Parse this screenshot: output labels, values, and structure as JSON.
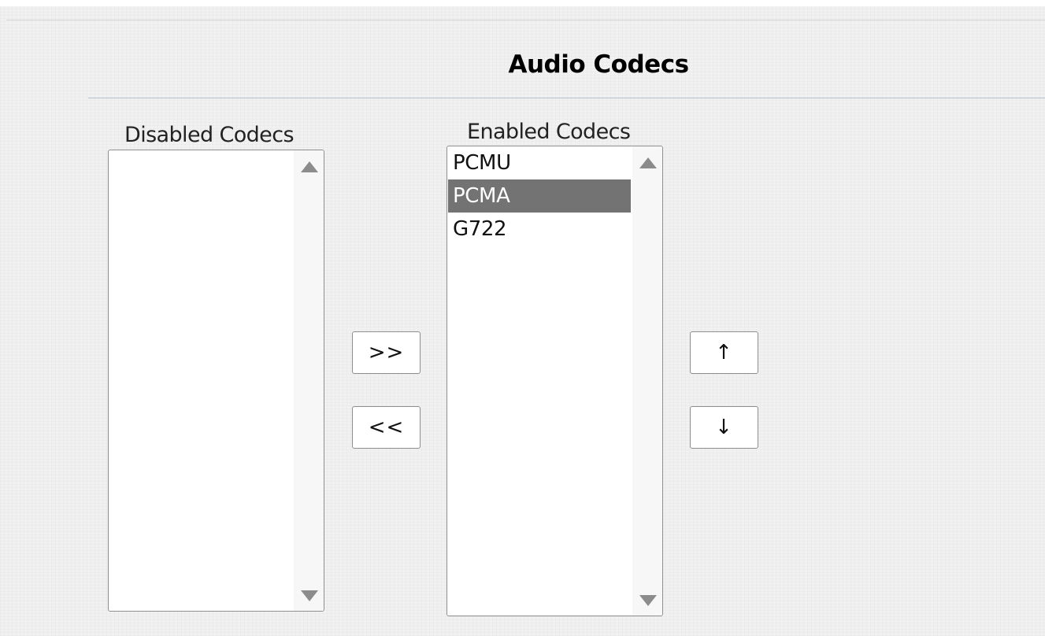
{
  "section": {
    "title": "Audio Codecs"
  },
  "disabled_list": {
    "label": "Disabled Codecs",
    "items": []
  },
  "enabled_list": {
    "label": "Enabled Codecs",
    "items": [
      {
        "label": "PCMU",
        "selected": false
      },
      {
        "label": "PCMA",
        "selected": true
      },
      {
        "label": "G722",
        "selected": false
      }
    ]
  },
  "buttons": {
    "add_label": ">>",
    "remove_label": "<<",
    "move_up_label": "↑",
    "move_down_label": "↓"
  },
  "colors": {
    "selection_bg": "#737373",
    "selection_text": "#ffffff",
    "scroll_arrow": "#8c8c8c",
    "title_rule": "#b7c3d3"
  },
  "icons": {
    "scroll_up": "triangle-up-icon",
    "scroll_down": "triangle-down-icon"
  }
}
